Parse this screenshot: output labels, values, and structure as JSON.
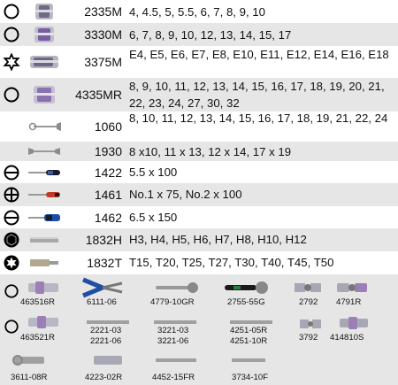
{
  "rows": [
    {
      "code": "2335M",
      "sizes": "4, 4.5, 5, 5.5, 6, 7, 8, 9, 10",
      "symbol": "circle-icon"
    },
    {
      "code": "3330M",
      "sizes": "6, 7, 8, 9, 10, 12, 13, 14, 15, 17",
      "symbol": "circle-icon"
    },
    {
      "code": "3375M",
      "sizes": "E4, E5, E6, E7, E8, E10, E11, E12, E14, E16, E18",
      "symbol": "star-icon"
    },
    {
      "code": "4335MR",
      "sizes": "8, 9, 10, 11, 12, 13, 14, 15, 16, 17, 18, 19, 20, 21, 22, 23, 24, 27, 30, 32",
      "symbol": "circle-icon"
    },
    {
      "code": "1060",
      "sizes": "8, 10, 11, 12, 13, 14, 15, 16, 17, 18, 19, 21, 22, 24",
      "symbol": ""
    },
    {
      "code": "1930",
      "sizes": "8 x10, 11 x 13, 12 x 14, 17 x 19",
      "symbol": ""
    },
    {
      "code": "1422",
      "sizes": "5.5 x 100",
      "symbol": "slotted-icon"
    },
    {
      "code": "1461",
      "sizes": "No.1 x 75, No.2 x 100",
      "symbol": "phillips-icon"
    },
    {
      "code": "1462",
      "sizes": "6.5 x 150",
      "symbol": "slotted-icon"
    },
    {
      "code": "1832H",
      "sizes": "H3, H4, H5, H6, H7, H8, H10, H12",
      "symbol": "hex-icon"
    },
    {
      "code": "1832T",
      "sizes": "T15, T20, T25, T27, T30, T40, T45, T50",
      "symbol": "torx-icon"
    }
  ],
  "accessories_row1": [
    "463516R",
    "6111-06",
    "4779-10GR",
    "2755-55G",
    "2792",
    "4791R"
  ],
  "accessories_row2": [
    "463521R",
    "2221-03",
    "2221-06",
    "3221-03",
    "3221-06",
    "4251-05R",
    "4251-10R",
    "3792",
    "414810S"
  ],
  "accessories_row3": [
    "3611-08R",
    "4223-02R",
    "4452-15FR",
    "3734-10F"
  ],
  "colors": {
    "band": "#e6e6e6",
    "handle_red": "#c0392b",
    "handle_blue": "#1f4fa3",
    "handle_dark": "#1a1a2e",
    "socket_purple": "#7a5fa0"
  }
}
